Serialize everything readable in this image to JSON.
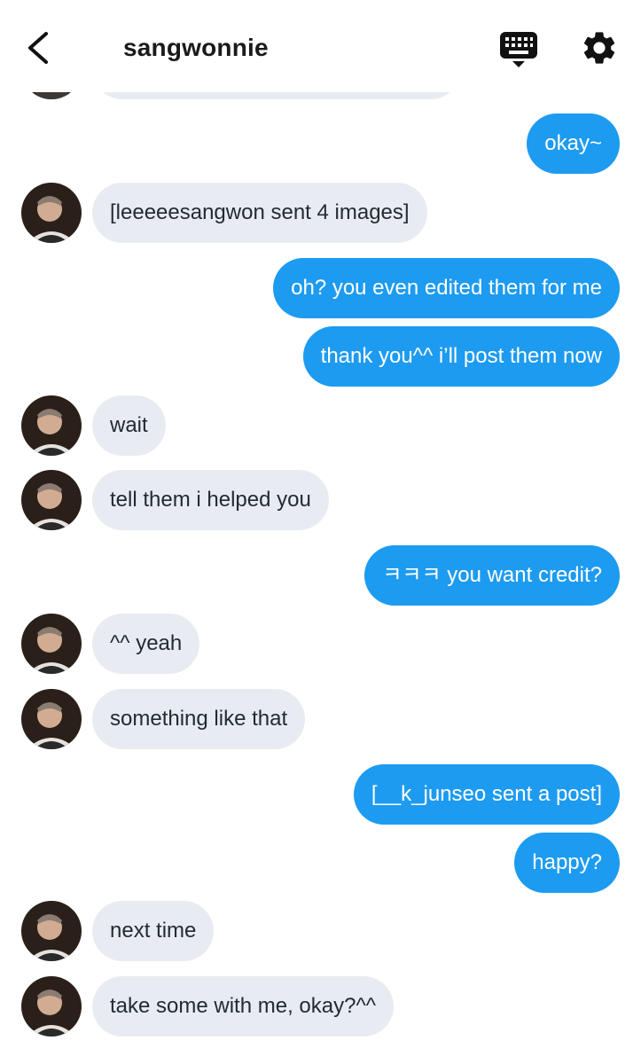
{
  "header": {
    "title": "sangwonnie"
  },
  "icons": {
    "back": "chevron-left-icon",
    "keyboard": "keyboard-icon",
    "settings": "gear-icon"
  },
  "colors": {
    "outgoing": "#1d9bf0",
    "incoming": "#e8ecf2",
    "incoming_text": "#222b33"
  },
  "messages": [
    {
      "side": "out",
      "text": "okay~"
    },
    {
      "side": "in",
      "text": "[leeeeesangwon sent 4 images]"
    },
    {
      "side": "out",
      "text": "oh? you even edited them for me"
    },
    {
      "side": "out",
      "text": "thank you^^ i’ll post them now"
    },
    {
      "side": "in",
      "text": "wait"
    },
    {
      "side": "in",
      "text": "tell them i helped you"
    },
    {
      "side": "out",
      "text": "ㅋㅋㅋ you want credit?"
    },
    {
      "side": "in",
      "text": "^^ yeah"
    },
    {
      "side": "in",
      "text": "something like that"
    },
    {
      "side": "out",
      "text": "[__k_junseo sent a post]"
    },
    {
      "side": "out",
      "text": "happy?"
    },
    {
      "side": "in",
      "text": "next time"
    },
    {
      "side": "in",
      "text": "take some with me, okay?^^"
    }
  ]
}
